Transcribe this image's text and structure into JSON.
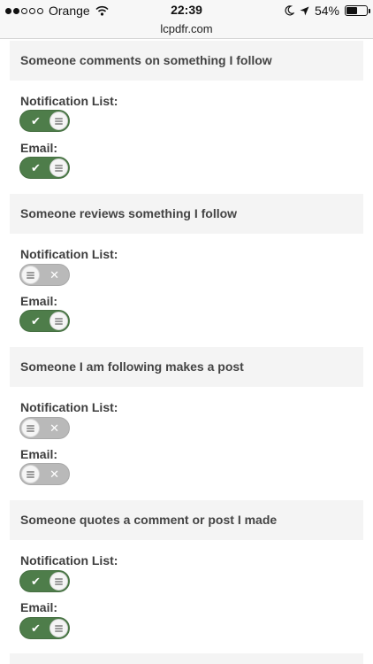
{
  "status_bar": {
    "carrier": "Orange",
    "time": "22:39",
    "battery": "54%",
    "battery_level": 0.54,
    "signal_bars_filled": 2,
    "signal_bars_total": 5,
    "icons": [
      "wifi-icon",
      "moon-icon",
      "location-arrow-icon",
      "battery-icon"
    ]
  },
  "url": "lcpdfr.com",
  "colors": {
    "toggle_on": "#4e7d4a",
    "toggle_off": "#b9b9b9",
    "section_bg": "#f4f4f4"
  },
  "sections": [
    {
      "title": "Someone comments on something I follow",
      "options": [
        {
          "label": "Notification List:",
          "enabled": true,
          "mark": "✔"
        },
        {
          "label": "Email:",
          "enabled": true,
          "mark": "✔"
        }
      ]
    },
    {
      "title": "Someone reviews something I follow",
      "options": [
        {
          "label": "Notification List:",
          "enabled": false,
          "mark": "✕"
        },
        {
          "label": "Email:",
          "enabled": true,
          "mark": "✔"
        }
      ]
    },
    {
      "title": "Someone I am following makes a post",
      "options": [
        {
          "label": "Notification List:",
          "enabled": false,
          "mark": "✕"
        },
        {
          "label": "Email:",
          "enabled": false,
          "mark": "✕"
        }
      ]
    },
    {
      "title": "Someone quotes a comment or post I made",
      "options": [
        {
          "label": "Notification List:",
          "enabled": true,
          "mark": "✔"
        },
        {
          "label": "Email:",
          "enabled": true,
          "mark": "✔"
        }
      ]
    }
  ]
}
